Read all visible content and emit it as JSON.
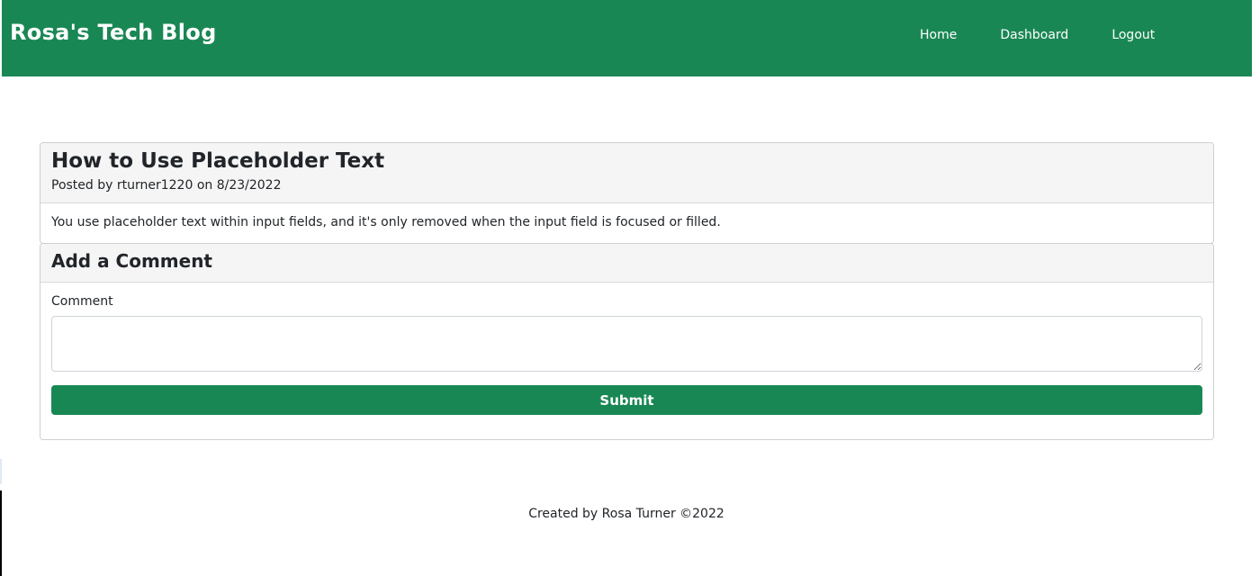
{
  "brand": "Rosa's Tech Blog",
  "nav": {
    "items": [
      {
        "label": "Home"
      },
      {
        "label": "Dashboard"
      },
      {
        "label": "Logout"
      }
    ]
  },
  "post": {
    "title": "How to Use Placeholder Text",
    "meta": "Posted by rturner1220 on 8/23/2022",
    "body": "You use placeholder text within input fields, and it's only removed when the input field is focused or filled."
  },
  "comment_form": {
    "title": "Add a Comment",
    "label": "Comment",
    "value": "",
    "submit_label": "Submit"
  },
  "footer": {
    "text": "Created by Rosa Turner ©2022"
  },
  "colors": {
    "brand_green": "#198754",
    "card_header_bg": "#f5f5f5"
  }
}
